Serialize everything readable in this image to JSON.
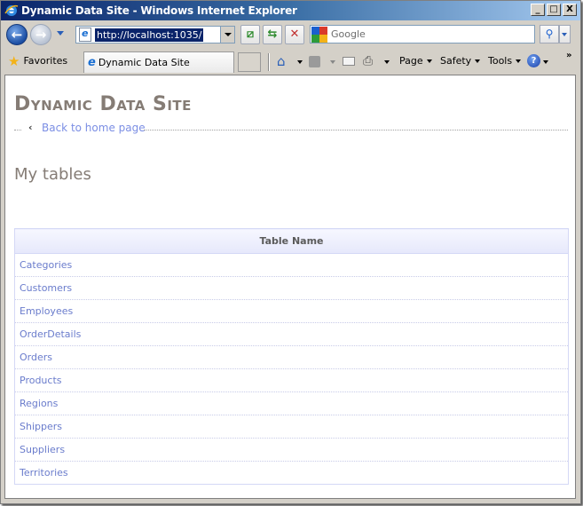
{
  "window": {
    "title": "Dynamic Data Site - Windows Internet Explorer",
    "controls": {
      "minimize": "_",
      "maximize": "□",
      "close": "X"
    }
  },
  "address_bar": {
    "url": "http://localhost:1035/"
  },
  "search": {
    "placeholder": "Google",
    "provider_colors": [
      "#1a5fcf",
      "#d93a2b",
      "#2d9b3a",
      "#f3b217"
    ]
  },
  "favorites": {
    "label": "Favorites"
  },
  "tab": {
    "label": "Dynamic Data Site"
  },
  "command_bar": {
    "menus": [
      {
        "label": "Page"
      },
      {
        "label": "Safety"
      },
      {
        "label": "Tools"
      }
    ],
    "help_label": "?",
    "overflow_label": "»"
  },
  "page": {
    "site_title": "Dynamic Data Site",
    "back_link": "Back to home page",
    "back_arrow": "‹",
    "section_heading": "My tables",
    "table": {
      "header": "Table Name",
      "rows": [
        "Categories",
        "Customers",
        "Employees",
        "OrderDetails",
        "Orders",
        "Products",
        "Regions",
        "Shippers",
        "Suppliers",
        "Territories"
      ]
    }
  },
  "colors": {
    "link": "#6a7ccc",
    "title_text": "#857c75",
    "table_border": "#d4d8f6",
    "titlebar_start": "#0a246a"
  }
}
